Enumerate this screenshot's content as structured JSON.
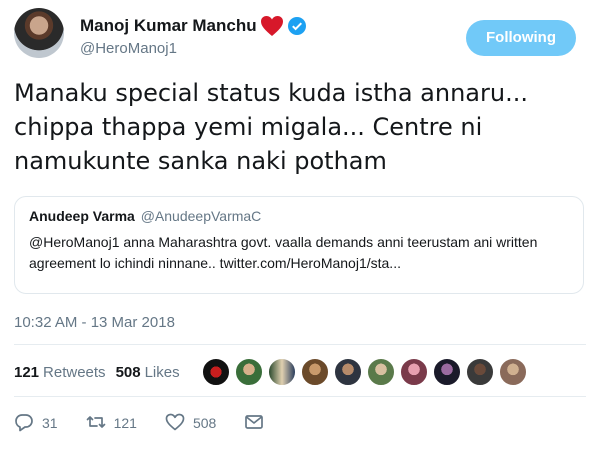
{
  "user": {
    "display_name": "Manoj Kumar Manchu",
    "handle": "@HeroManoj1",
    "follow_label": "Following"
  },
  "tweet": {
    "text": "Manaku special status kuda istha annaru... chippa thappa yemi migala... Centre ni namukunte sanka naki potham",
    "timestamp": "10:32 AM - 13 Mar 2018"
  },
  "quoted": {
    "name": "Anudeep Varma",
    "handle": "@AnudeepVarmaC",
    "text": "@HeroManoj1 anna Maharashtra govt. vaalla demands anni teerustam ani written agreement lo ichindi ninnane.. twitter.com/HeroManoj1/sta..."
  },
  "stats": {
    "retweets_count": "121",
    "retweets_label": "Retweets",
    "likes_count": "508",
    "likes_label": "Likes"
  },
  "actions": {
    "reply_count": "31",
    "retweet_count": "121",
    "like_count": "508"
  },
  "colors": {
    "follow_button": "#71c9f8",
    "verified": "#1da1f2",
    "heart": "#e0245e",
    "secondary_text": "#657786"
  },
  "icons": [
    "heart-emoji-icon",
    "verified-badge-icon",
    "reply-icon",
    "retweet-icon",
    "like-icon",
    "direct-message-icon"
  ]
}
